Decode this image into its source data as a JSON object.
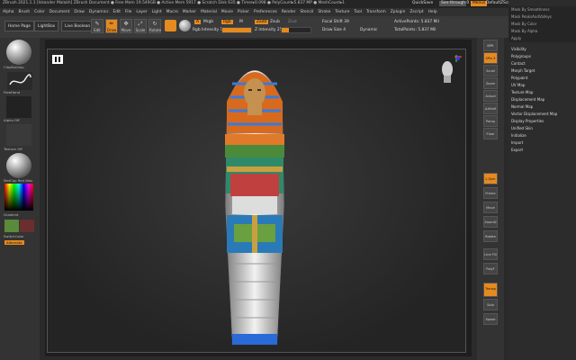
{
  "titlebar": {
    "title": "ZBrush 2021.1.1 [Iskander Malakh]   ZBrush Document   ● Free Mem 19.549GB ● Active Mem 5917 ● Scratch Disk 635 ● Timer▸0.098 ● PolyCount▸5.837 MP ● MeshCount▸1",
    "quicksave": "QuickSave",
    "seethrough": "See-through  0",
    "menus_btn": "Menus",
    "default_script": "DefaultZScript"
  },
  "menubar": {
    "items": [
      "Alpha",
      "Brush",
      "Color",
      "Document",
      "Draw",
      "Dynamics",
      "Edit",
      "File",
      "Layer",
      "Light",
      "Macro",
      "Marker",
      "Material",
      "Movie",
      "Picker",
      "Preferences",
      "Render",
      "Stencil",
      "Stroke",
      "Texture",
      "Tool",
      "Transform",
      "Zplugin",
      "Zscript",
      "Help"
    ]
  },
  "toolbar": {
    "home_page": "Home Page",
    "lightbox": "LightBox",
    "live_boolean": "Live Boolean",
    "tools": [
      {
        "label": "Edit",
        "icon": "✎"
      },
      {
        "label": "Draw",
        "icon": "✏"
      },
      {
        "label": "Move",
        "icon": "✥"
      },
      {
        "label": "Scale",
        "icon": "⤢"
      },
      {
        "label": "Rotate",
        "icon": "↻"
      }
    ],
    "a_label": "A",
    "mrgb": "Mrgb",
    "rgb": "Rgb",
    "m": "M",
    "zadd": "Zadd",
    "zsub": "Zsub",
    "zcut": "Zcut",
    "rgb_intensity": "Rgb Intensity 100",
    "z_intensity": "Z Intensity 25",
    "focal_shift": "Focal Shift  39",
    "draw_size": "Draw Size  4",
    "dynamic": "Dynamic",
    "active_points": "ActivePoints: 5.837 Mil",
    "total_points": "TotalPoints: 5.837 Mil"
  },
  "leftshelf": {
    "mat1": "ClayBuildup",
    "stroke": "FreeHand",
    "alpha": "Alpha Off",
    "texture": "Texture Off",
    "material": "MatCap Red Wax",
    "gradient": "Gradient",
    "switchcolor": "SwitchColor",
    "alternate": "Alternate"
  },
  "rightshelf": [
    "BPR",
    "SPix 3",
    "Scroll",
    "Zoom",
    "Actual",
    "AAHalf",
    "Persp",
    "Floor",
    "L.Sym",
    "Frame",
    "Move",
    "ZoomD",
    "Rotate",
    "Line Fill",
    "PolyF",
    "Transp",
    "Solo",
    "Xpose"
  ],
  "tray": {
    "dropdown": [
      "Mask By Smoothness",
      "Mask PeaksAndValleys",
      "Mask By Color",
      "Mask By Alpha",
      "Apply"
    ],
    "items": [
      "Visibility",
      "Polygroups",
      "Contact",
      "Morph Target",
      "Polypaint",
      "UV Map",
      "Texture Map",
      "Displacement Map",
      "Normal Map",
      "Vector Displacement Map",
      "Display Properties",
      "Unified Skin",
      "Initialize",
      "Import",
      "Export"
    ]
  },
  "colors": {
    "accent": "#e58a1f",
    "main_color": "#000000",
    "secondary": "#5a8a3a"
  }
}
